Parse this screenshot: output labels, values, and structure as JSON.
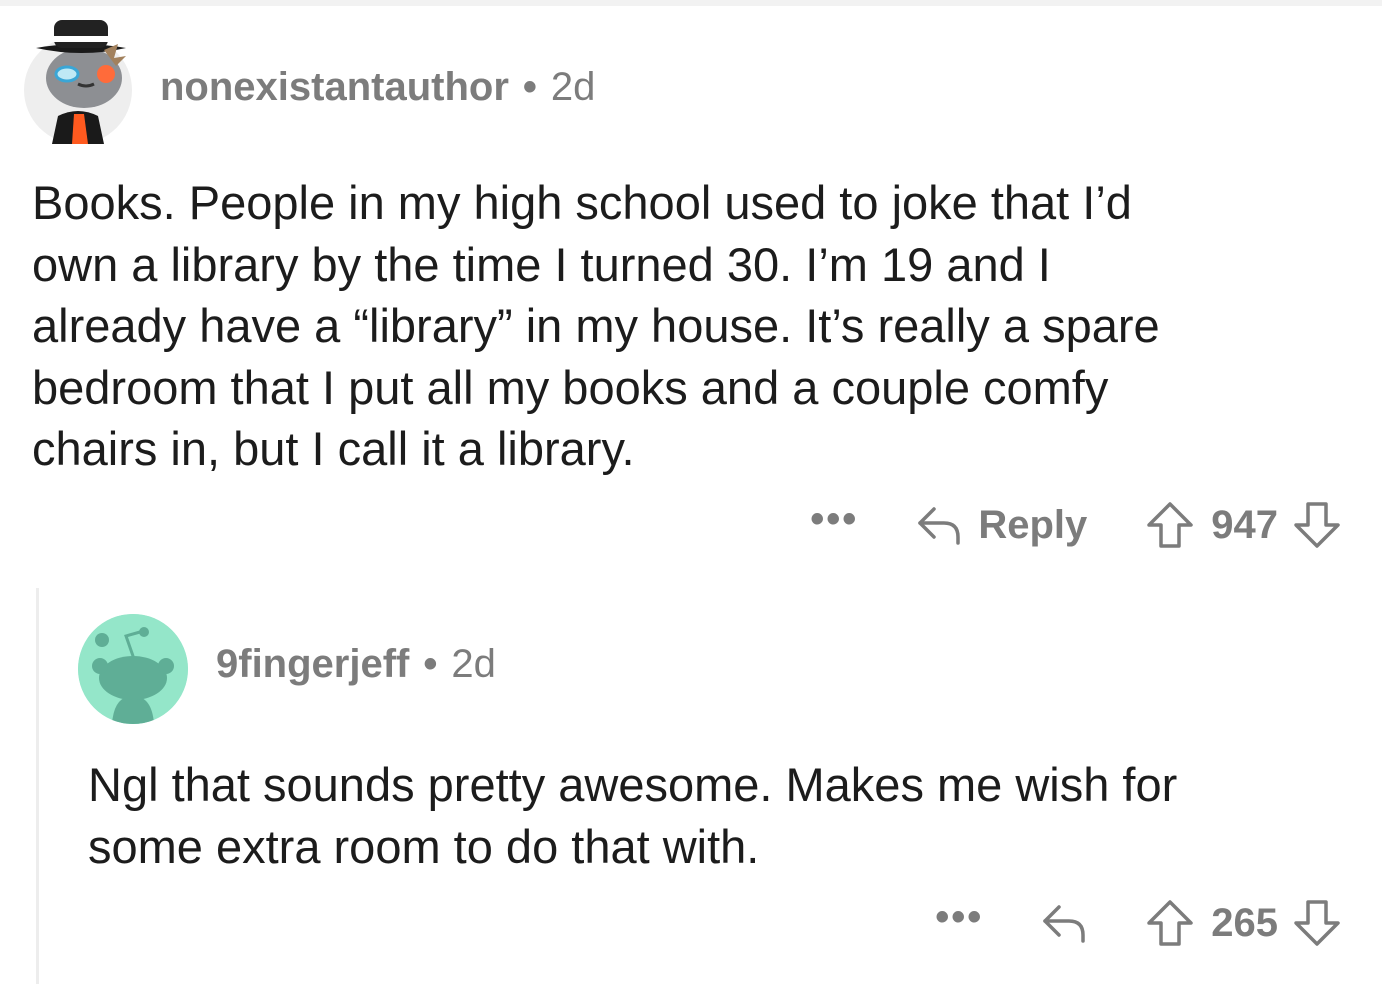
{
  "comments": [
    {
      "username": "nonexistantauthor",
      "separator": "•",
      "age": "2d",
      "avatar_icon": "snoo-avatar-fedora-icon",
      "body": "Books. People in my high school used to joke that I’d\nown a library by the time I turned 30. I’m 19 and I\nalready have a “library” in my house. It’s really a spare\nbedroom that I put all my books and a couple comfy\nchairs in, but I call it a library.",
      "actions": {
        "more": "•••",
        "reply_label": "Reply",
        "score": "947"
      }
    },
    {
      "username": "9fingerjeff",
      "separator": "•",
      "age": "2d",
      "avatar_icon": "snoo-avatar-default-icon",
      "body": "Ngl that sounds pretty awesome. Makes me wish for\nsome extra room to do that with.",
      "actions": {
        "more": "•••",
        "score": "265"
      }
    }
  ],
  "colors": {
    "meta_gray": "#7c7c7c",
    "body_text": "#1c1c1c",
    "thread_line": "#ededed",
    "reply_avatar_bg": "#94e6c9"
  }
}
